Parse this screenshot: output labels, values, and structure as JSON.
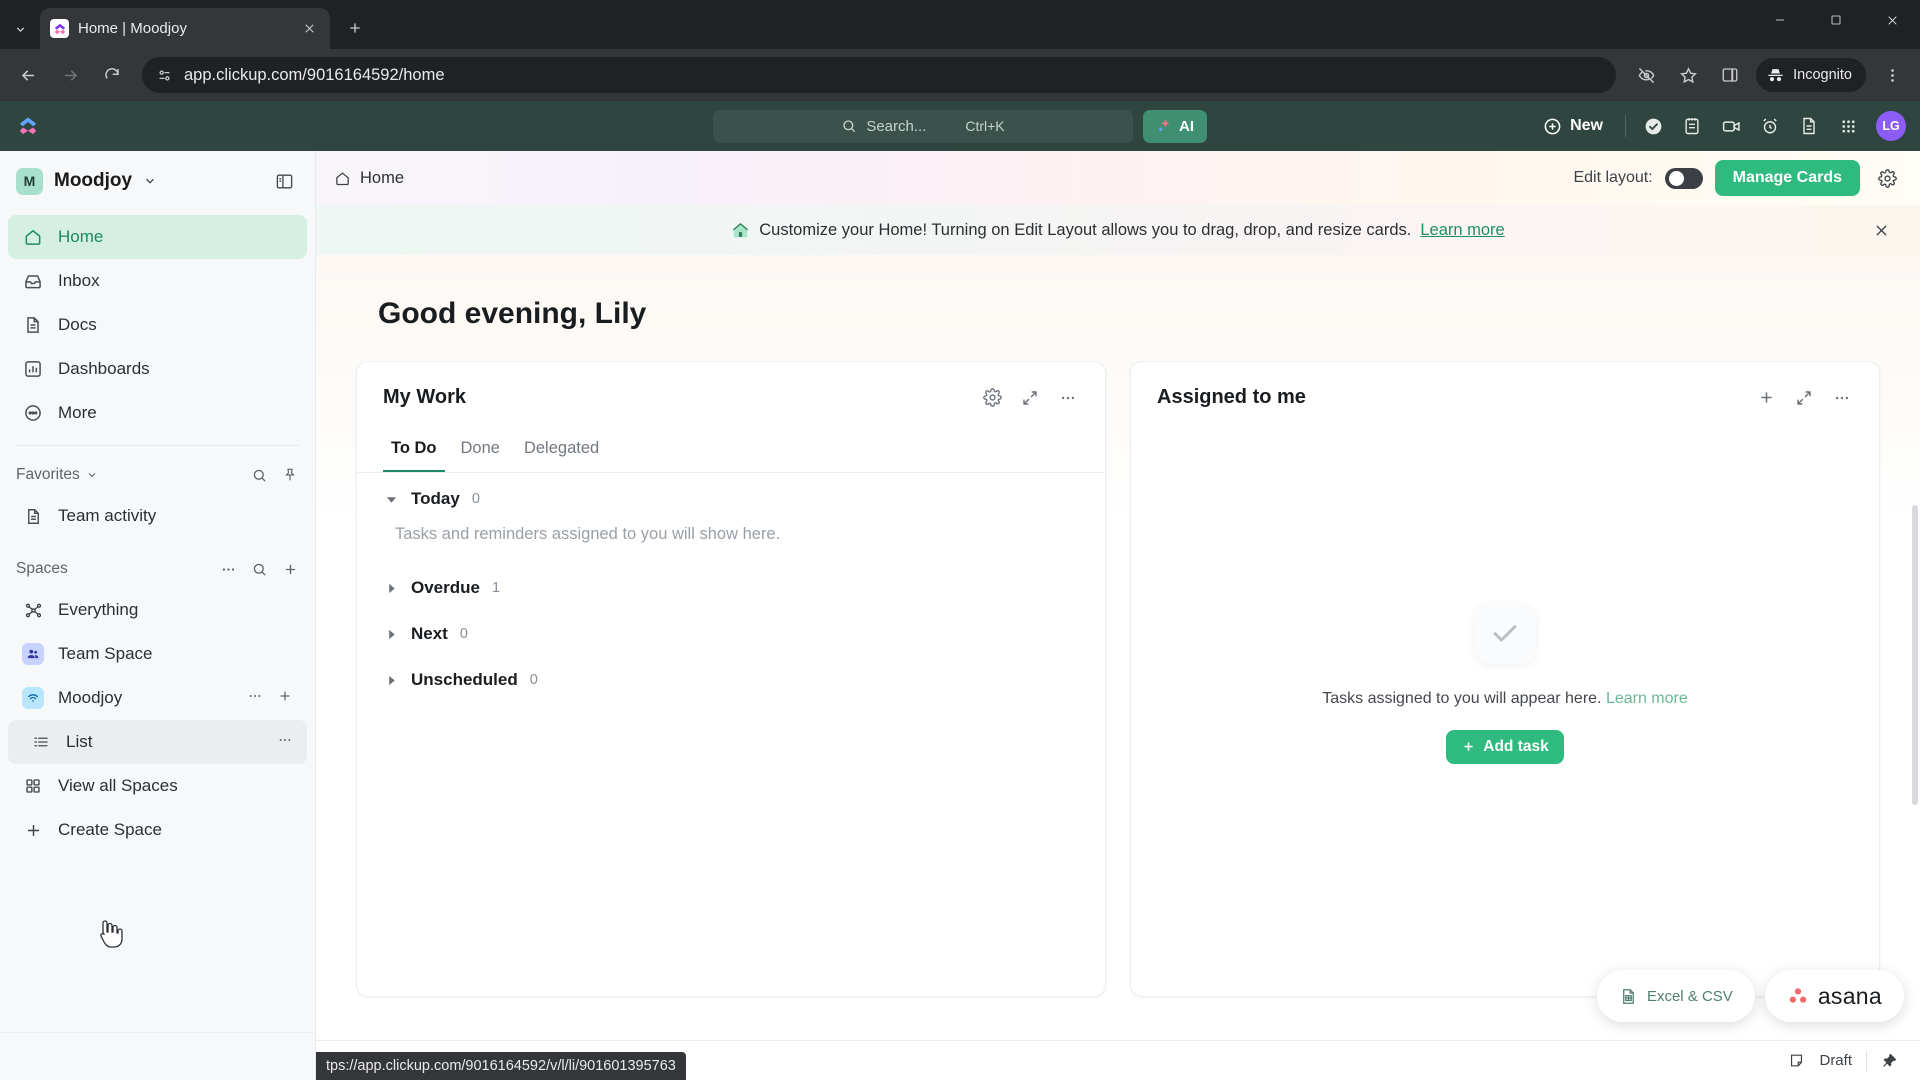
{
  "browser": {
    "tab": {
      "title": "Home | Moodjoy",
      "favicon_icon": "clickup-favicon",
      "close_icon": "close-icon"
    },
    "new_tab_icon": "plus-icon",
    "tab_list_chevron_icon": "chevron-down-icon",
    "window": {
      "minimize_icon": "minimize-icon",
      "maximize_icon": "maximize-icon",
      "close_icon": "close-icon"
    },
    "nav": {
      "back_icon": "back-arrow-icon",
      "forward_icon": "forward-arrow-icon",
      "reload_icon": "reload-icon"
    },
    "omnibox": {
      "url": "app.clickup.com/9016164592/home",
      "site_info_icon": "site-settings-icon"
    },
    "actions": {
      "tracking_icon": "eye-slash-icon",
      "bookmark_icon": "star-icon",
      "side_panel_icon": "side-panel-icon",
      "incognito_label": "Incognito",
      "incognito_icon": "incognito-hat-icon",
      "menu_icon": "kebab-menu-icon"
    }
  },
  "topbar": {
    "logo_icon": "clickup-logo-icon",
    "search": {
      "placeholder": "Search...",
      "icon": "search-icon",
      "shortcut": "Ctrl+K"
    },
    "ai_button": {
      "label": "AI",
      "icon": "ai-sparkle-icon"
    },
    "new_button": {
      "label": "New",
      "icon": "plus-circle-icon"
    },
    "icons": [
      {
        "name": "task-check-icon"
      },
      {
        "name": "notepad-icon"
      },
      {
        "name": "video-camera-icon"
      },
      {
        "name": "alarm-clock-icon"
      },
      {
        "name": "document-icon"
      },
      {
        "name": "apps-grid-icon"
      }
    ],
    "avatar": {
      "initials": "LG",
      "color": "#8b5cf6"
    }
  },
  "sidebar": {
    "workspace": {
      "badge": "M",
      "name": "Moodjoy",
      "chevron_icon": "chevron-down-icon"
    },
    "panel_toggle_icon": "sidebar-toggle-icon",
    "nav": [
      {
        "label": "Home",
        "icon": "home-icon",
        "active": true
      },
      {
        "label": "Inbox",
        "icon": "inbox-icon",
        "active": false
      },
      {
        "label": "Docs",
        "icon": "docs-icon",
        "active": false
      },
      {
        "label": "Dashboards",
        "icon": "dashboards-icon",
        "active": false
      },
      {
        "label": "More",
        "icon": "more-circle-icon",
        "active": false
      }
    ],
    "favorites": {
      "title": "Favorites",
      "chevron_icon": "chevron-down-icon",
      "search_icon": "search-icon",
      "pin_icon": "pin-icon",
      "items": [
        {
          "label": "Team activity",
          "icon": "docs-icon"
        }
      ]
    },
    "spaces": {
      "title": "Spaces",
      "more_icon": "ellipsis-icon",
      "search_icon": "search-icon",
      "add_icon": "plus-icon",
      "items": [
        {
          "label": "Everything",
          "icon": "everything-icon"
        },
        {
          "label": "Team Space",
          "icon": "people-icon"
        },
        {
          "label": "Moodjoy",
          "icon": "wifi-icon"
        },
        {
          "label": "List",
          "icon": "list-icon"
        }
      ],
      "view_all": {
        "label": "View all Spaces",
        "icon": "grid-icon"
      },
      "create": {
        "label": "Create Space",
        "icon": "plus-icon"
      }
    }
  },
  "main": {
    "breadcrumb": {
      "label": "Home",
      "icon": "home-icon"
    },
    "edit_layout": {
      "label": "Edit layout:",
      "enabled": false
    },
    "manage_cards_label": "Manage Cards",
    "settings_icon": "gear-icon",
    "banner": {
      "icon": "house-icon",
      "text": "Customize your Home! Turning on Edit Layout allows you to drag, drop, and resize cards.",
      "link": "Learn more",
      "close_icon": "close-icon"
    },
    "greeting": "Good evening, Lily",
    "cards": [
      {
        "title": "My Work",
        "actions": [
          "gear-icon",
          "expand-icon",
          "ellipsis-icon"
        ],
        "tabs": [
          {
            "label": "To Do",
            "active": true
          },
          {
            "label": "Done",
            "active": false
          },
          {
            "label": "Delegated",
            "active": false
          }
        ],
        "groups": [
          {
            "name": "Today",
            "count": "0",
            "expanded": true,
            "empty_text": "Tasks and reminders assigned to you will show here."
          },
          {
            "name": "Overdue",
            "count": "1",
            "expanded": false
          },
          {
            "name": "Next",
            "count": "0",
            "expanded": false
          },
          {
            "name": "Unscheduled",
            "count": "0",
            "expanded": false
          }
        ]
      },
      {
        "title": "Assigned to me",
        "actions": [
          "plus-icon",
          "expand-icon",
          "ellipsis-icon"
        ],
        "empty": {
          "icon": "check-icon",
          "text": "Tasks assigned to you will appear here.",
          "link": "Learn more",
          "button": {
            "label": "Add task",
            "icon": "plus-icon"
          }
        }
      }
    ],
    "float_widgets": [
      {
        "label": "Excel & CSV",
        "icon": "spreadsheet-icon"
      },
      {
        "label": "asana",
        "icon": "asana-logo-icon"
      }
    ]
  },
  "statusbar": {
    "link_preview": "tps://app.clickup.com/9016164592/v/l/li/901601395763",
    "draft_label": "Draft",
    "draft_icon": "note-icon",
    "pin_icon": "pin-icon"
  }
}
